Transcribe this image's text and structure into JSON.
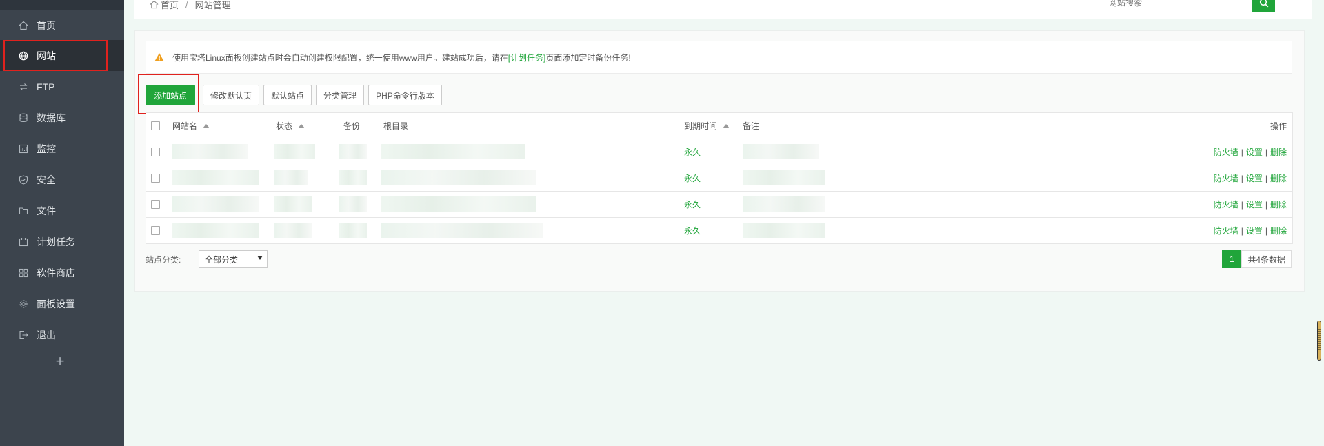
{
  "sidebar": {
    "items": [
      {
        "label": "首页",
        "icon": "home-icon"
      },
      {
        "label": "网站",
        "icon": "globe-icon"
      },
      {
        "label": "FTP",
        "icon": "ftp-icon"
      },
      {
        "label": "数据库",
        "icon": "database-icon"
      },
      {
        "label": "监控",
        "icon": "monitor-icon"
      },
      {
        "label": "安全",
        "icon": "shield-icon"
      },
      {
        "label": "文件",
        "icon": "folder-icon"
      },
      {
        "label": "计划任务",
        "icon": "calendar-icon"
      },
      {
        "label": "软件商店",
        "icon": "apps-icon"
      },
      {
        "label": "面板设置",
        "icon": "gear-icon"
      },
      {
        "label": "退出",
        "icon": "logout-icon"
      }
    ],
    "active": "网站",
    "add_symbol": "+"
  },
  "header": {
    "breadcrumb_home": "首页",
    "breadcrumb_sep": "/",
    "breadcrumb_current": "网站管理",
    "search_placeholder": "网站搜索"
  },
  "alert": {
    "text_before": "使用宝塔Linux面板创建站点时会自动创建权限配置，统一使用www用户。建站成功后，请在",
    "link": "[计划任务]",
    "text_after": "页面添加定时备份任务!"
  },
  "toolbar": {
    "add_site": "添加站点",
    "modify_default": "修改默认页",
    "default_site": "默认站点",
    "category_manage": "分类管理",
    "php_cli": "PHP命令行版本"
  },
  "table": {
    "headers": {
      "name": "网站名",
      "status": "状态",
      "backup": "备份",
      "root": "根目录",
      "expire": "到期时间",
      "remark": "备注",
      "ops": "操作"
    },
    "rows": [
      {
        "expire": "永久",
        "op_firewall": "防火墙",
        "op_settings": "设置",
        "op_delete": "删除"
      },
      {
        "expire": "永久",
        "op_firewall": "防火墙",
        "op_settings": "设置",
        "op_delete": "删除"
      },
      {
        "expire": "永久",
        "op_firewall": "防火墙",
        "op_settings": "设置",
        "op_delete": "删除"
      },
      {
        "expire": "永久",
        "op_firewall": "防火墙",
        "op_settings": "设置",
        "op_delete": "删除"
      }
    ]
  },
  "footer": {
    "category_label": "站点分类:",
    "category_value": "全部分类",
    "page_current": "1",
    "total_text": "共4条数据"
  },
  "colors": {
    "accent": "#20a53a",
    "sidebar_bg": "#3c444d",
    "highlight_box": "#e0221e"
  }
}
